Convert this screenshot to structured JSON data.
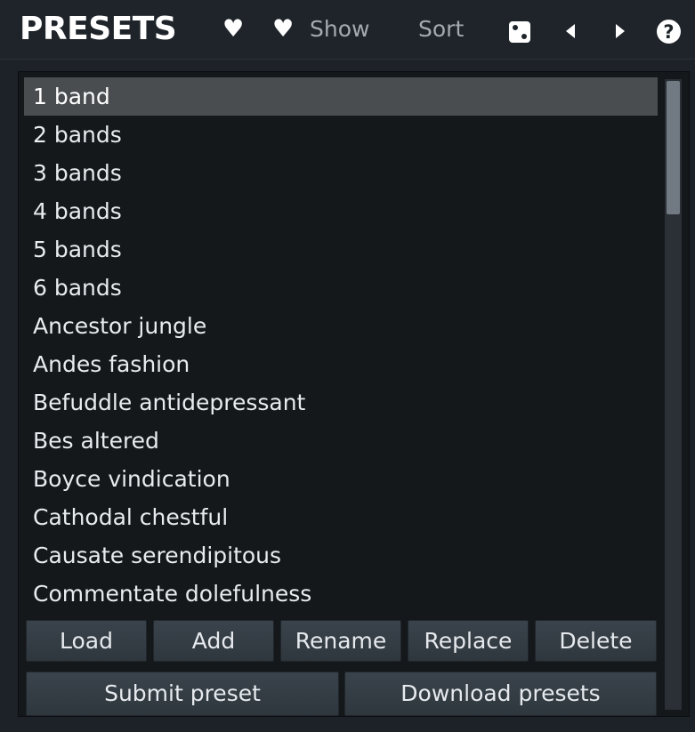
{
  "header": {
    "title": "PRESETS",
    "favorite_icon": "heart-icon",
    "show_label": "Show",
    "show_icon": "heart-icon",
    "sort_label": "Sort",
    "random_icon": "dice-icon",
    "prev_icon": "triangle-left-icon",
    "next_icon": "triangle-right-icon",
    "help_label": "?"
  },
  "presets": {
    "selected_index": 0,
    "items": [
      "1 band",
      "2 bands",
      "3 bands",
      "4 bands",
      "5 bands",
      "6 bands",
      "Ancestor jungle",
      "Andes fashion",
      "Befuddle antidepressant",
      "Bes altered",
      "Boyce vindication",
      "Cathodal chestful",
      "Causate serendipitous",
      "Commentate dolefulness"
    ]
  },
  "actions": {
    "load": "Load",
    "add": "Add",
    "rename": "Rename",
    "replace": "Replace",
    "delete": "Delete",
    "submit": "Submit preset",
    "download": "Download presets"
  },
  "colors": {
    "background": "#1c2227",
    "list_background": "#14181b",
    "selected_row": "#4a4d50",
    "text": "#e8ecef",
    "muted_text": "#a3aab0",
    "button": "#353e45"
  }
}
